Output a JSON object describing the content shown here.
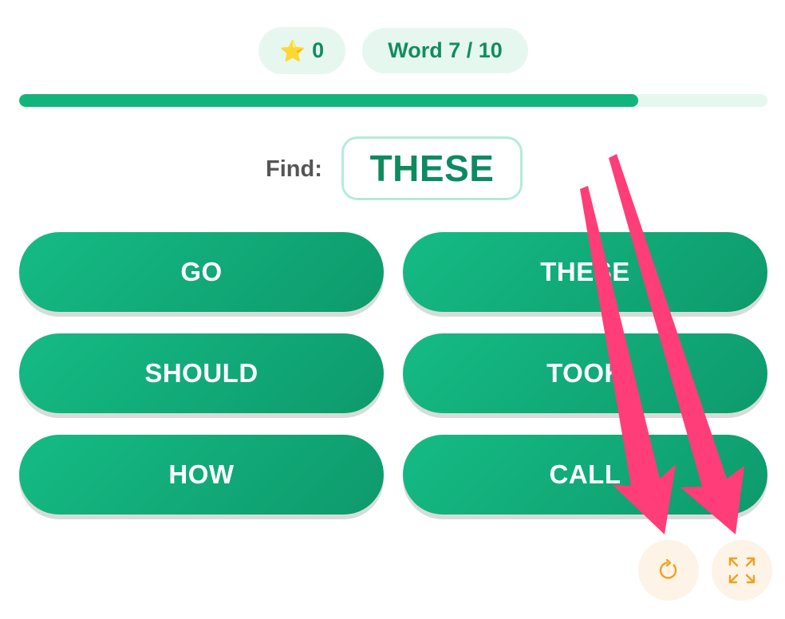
{
  "header": {
    "score_icon": "star-icon",
    "score": "0",
    "word_progress": "Word 7 / 10"
  },
  "progress": {
    "fraction": 0.827,
    "fill_color": "#13b47c",
    "track_color": "#e6f7ef"
  },
  "prompt": {
    "label": "Find:",
    "target_word": "THESE"
  },
  "options": [
    {
      "label": "GO"
    },
    {
      "label": "THESE"
    },
    {
      "label": "SHOULD"
    },
    {
      "label": "TOOK"
    },
    {
      "label": "HOW"
    },
    {
      "label": "CALL"
    }
  ],
  "controls": {
    "restart_icon": "restart-icon",
    "fullscreen_icon": "fullscreen-icon",
    "icon_color": "#f0a020"
  },
  "annotations": {
    "arrow_color": "#ff3d78",
    "arrow_count": 2
  }
}
